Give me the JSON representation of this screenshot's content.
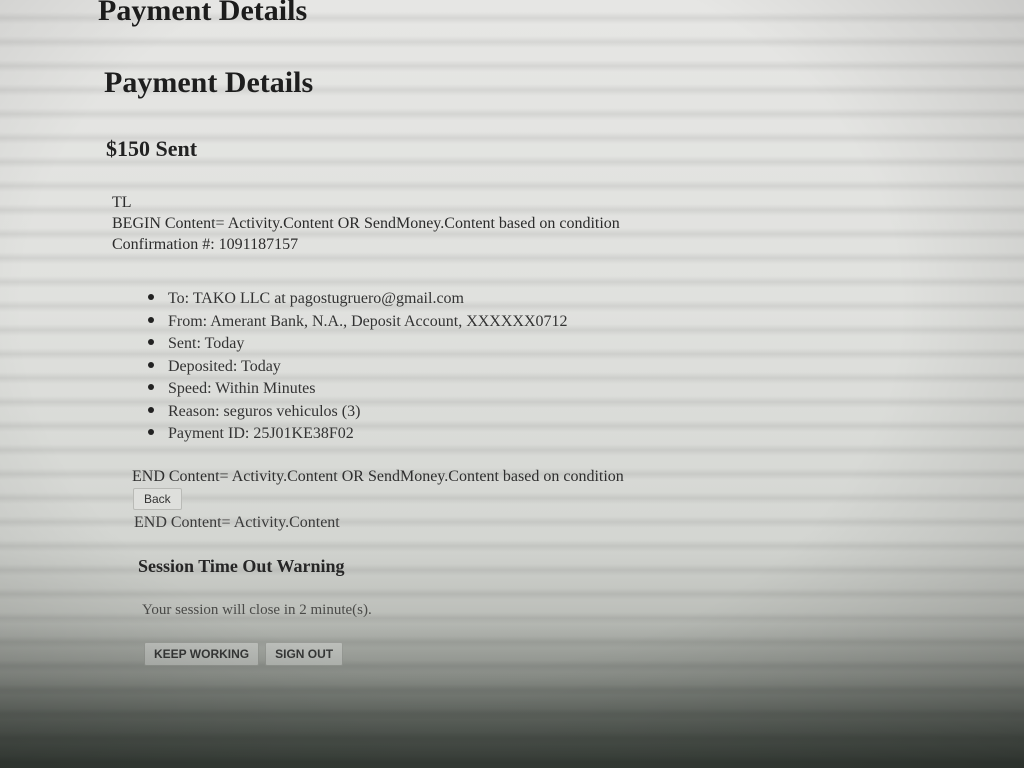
{
  "page": {
    "heading_top": "Payment Details",
    "heading_main": "Payment Details",
    "amount_sent": "$150 Sent",
    "tl_label": "TL",
    "begin_content": "BEGIN Content= Activity.Content OR SendMoney.Content based on condition",
    "confirmation": "Confirmation #: 1091187157"
  },
  "details": [
    "To: TAKO LLC at pagostugruero@gmail.com",
    "From: Amerant Bank, N.A., Deposit Account, XXXXXX0712",
    "Sent: Today",
    "Deposited: Today",
    "Speed: Within Minutes",
    "Reason: seguros vehiculos (3)",
    "Payment ID: 25J01KE38F02"
  ],
  "footer": {
    "end_content_1": "END Content= Activity.Content OR SendMoney.Content based on condition",
    "back_label": "Back",
    "end_content_2": "END Content= Activity.Content"
  },
  "session_warning": {
    "title": "Session Time Out Warning",
    "message": "Your session will close in 2 minute(s).",
    "keep_working_label": "KEEP WORKING",
    "sign_out_label": "SIGN OUT"
  }
}
